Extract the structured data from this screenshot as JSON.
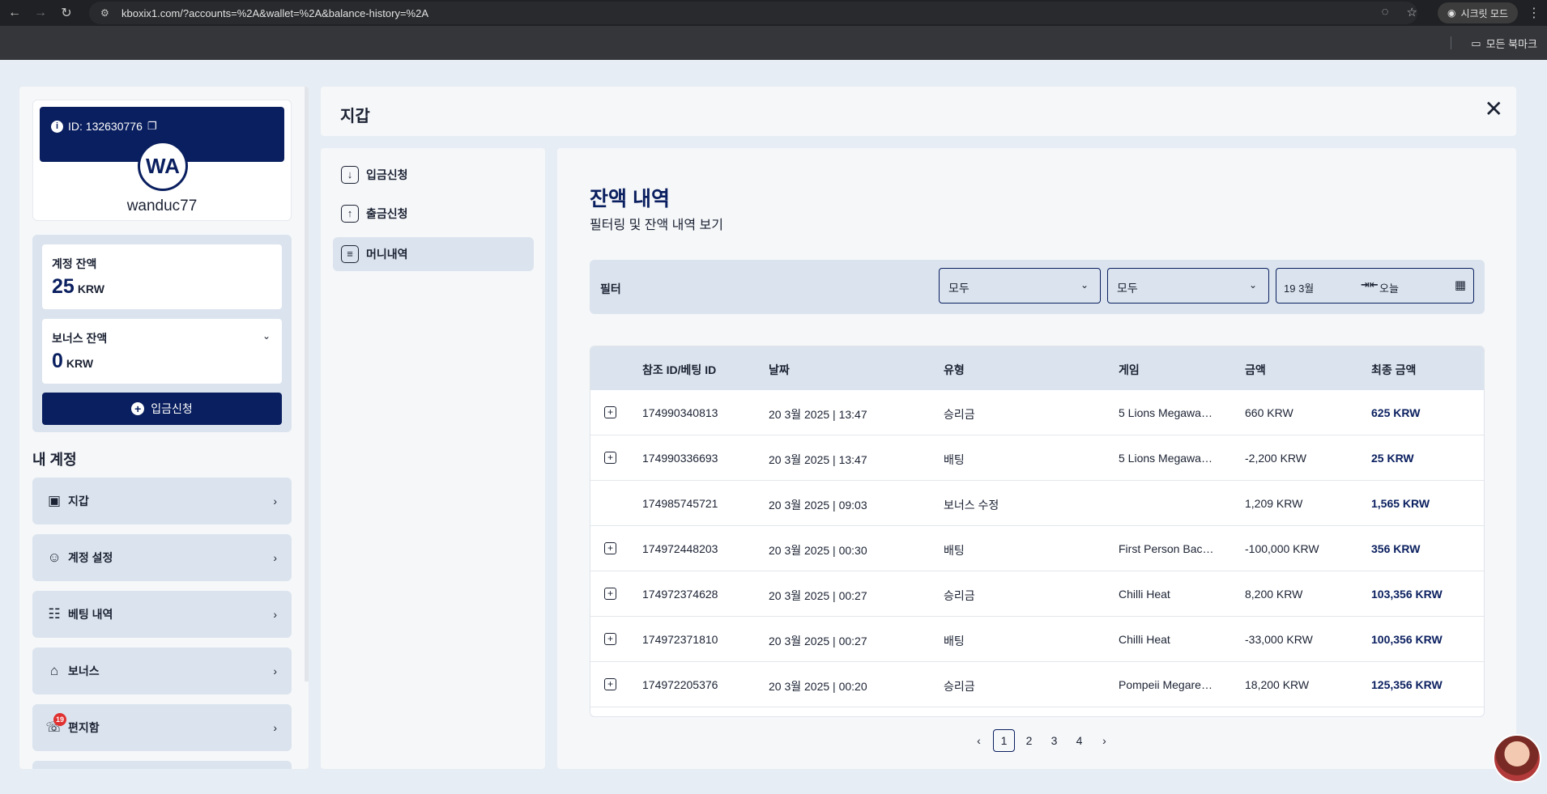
{
  "browser": {
    "url": "kboxix1.com/?accounts=%2A&wallet=%2A&balance-history=%2A",
    "incognito_label": "시크릿 모드",
    "bookmarks_label": "모든 북마크"
  },
  "sidebar": {
    "profile": {
      "id_text": "ID: 132630776",
      "avatar_initials": "WA",
      "username": "wanduc77"
    },
    "account_balance": {
      "label": "계정 잔액",
      "value": "25",
      "currency": "KRW"
    },
    "bonus_balance": {
      "label": "보너스 잔액",
      "value": "0",
      "currency": "KRW"
    },
    "deposit_button": "입금신청",
    "section_title": "내 계정",
    "menu": [
      {
        "label": "지갑",
        "icon": "wallet-icon"
      },
      {
        "label": "계정 설정",
        "icon": "user-settings-icon"
      },
      {
        "label": "베팅 내역",
        "icon": "receipt-icon"
      },
      {
        "label": "보너스",
        "icon": "gift-icon"
      },
      {
        "label": "편지함",
        "icon": "chat-icon",
        "badge": "19"
      }
    ]
  },
  "wallet": {
    "title": "지갑",
    "nav": [
      {
        "label": "입금신청",
        "icon": "download-icon"
      },
      {
        "label": "출금신청",
        "icon": "upload-icon"
      },
      {
        "label": "머니내역",
        "icon": "document-icon",
        "active": true
      }
    ]
  },
  "history": {
    "title": "잔액 내역",
    "subtitle": "필터링 및 잔액 내역 보기",
    "filter": {
      "label": "필터",
      "select1": "모두",
      "select2": "모두",
      "date_from": "19 3월",
      "date_to": "오늘"
    },
    "columns": [
      "참조 ID/베팅 ID",
      "날짜",
      "유형",
      "게임",
      "금액",
      "최종 금액"
    ],
    "rows": [
      {
        "expand": true,
        "id": "174990340813",
        "date": "20 3월 2025 | 13:47",
        "type": "승리금",
        "game": "5 Lions Megawa…",
        "amount": "660 KRW",
        "final": "625 KRW"
      },
      {
        "expand": true,
        "id": "174990336693",
        "date": "20 3월 2025 | 13:47",
        "type": "배팅",
        "game": "5 Lions Megawa…",
        "amount": "-2,200 KRW",
        "final": "25 KRW"
      },
      {
        "expand": false,
        "id": "174985745721",
        "date": "20 3월 2025 | 09:03",
        "type": "보너스 수정",
        "game": "",
        "amount": "1,209 KRW",
        "final": "1,565 KRW"
      },
      {
        "expand": true,
        "id": "174972448203",
        "date": "20 3월 2025 | 00:30",
        "type": "배팅",
        "game": "First Person Bac…",
        "amount": "-100,000 KRW",
        "final": "356 KRW"
      },
      {
        "expand": true,
        "id": "174972374628",
        "date": "20 3월 2025 | 00:27",
        "type": "승리금",
        "game": "Chilli Heat",
        "amount": "8,200 KRW",
        "final": "103,356 KRW"
      },
      {
        "expand": true,
        "id": "174972371810",
        "date": "20 3월 2025 | 00:27",
        "type": "배팅",
        "game": "Chilli Heat",
        "amount": "-33,000 KRW",
        "final": "100,356 KRW"
      },
      {
        "expand": true,
        "id": "174972205376",
        "date": "20 3월 2025 | 00:20",
        "type": "승리금",
        "game": "Pompeii Megare…",
        "amount": "18,200 KRW",
        "final": "125,356 KRW"
      }
    ],
    "pagination": {
      "pages": [
        "1",
        "2",
        "3",
        "4"
      ],
      "current": "1",
      "prev": "‹",
      "next": "›"
    }
  },
  "colors": {
    "navy": "#0a1f5f",
    "panel": "#f6f7f9",
    "muted_bg": "#dbe4ee",
    "page_bg": "#e6edf4"
  }
}
